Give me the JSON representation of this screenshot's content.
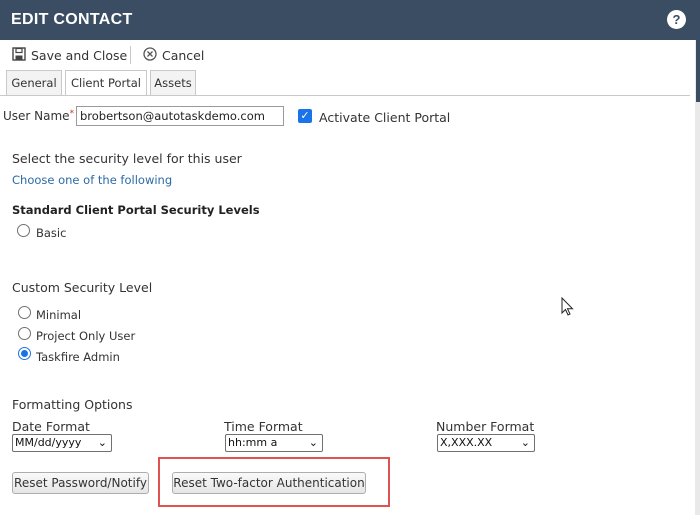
{
  "window": {
    "title": "EDIT CONTACT",
    "help_label": "?"
  },
  "toolbar": {
    "save_close_label": "Save and Close",
    "cancel_label": "Cancel"
  },
  "tabs": [
    {
      "label": "General",
      "active": false
    },
    {
      "label": "Client Portal",
      "active": true
    },
    {
      "label": "Assets",
      "active": false
    }
  ],
  "user": {
    "username_label": "User Name",
    "required_marker": "*",
    "username_value": "brobertson@autotaskdemo.com",
    "activate_label": "Activate Client Portal",
    "activate_checked": true
  },
  "security": {
    "heading": "Select the security level for this user",
    "choose_link": "Choose one of the following",
    "standard_heading": "Standard Client Portal Security Levels",
    "standard_options": [
      {
        "label": "Basic",
        "selected": false
      }
    ],
    "custom_heading": "Custom Security Level",
    "custom_options": [
      {
        "label": "Minimal",
        "selected": false
      },
      {
        "label": "Project Only User",
        "selected": false
      },
      {
        "label": "Taskfire Admin",
        "selected": true
      }
    ]
  },
  "formatting": {
    "heading": "Formatting Options",
    "date_label": "Date Format",
    "date_value": "MM/dd/yyyy",
    "time_label": "Time Format",
    "time_value": "hh:mm a",
    "number_label": "Number Format",
    "number_value": "X,XXX.XX"
  },
  "buttons": {
    "reset_password": "Reset Password/Notify",
    "reset_2fa": "Reset Two-factor Authentication"
  },
  "colors": {
    "titlebar": "#3a4d63",
    "accent": "#1a73e8",
    "highlight": "#e05252",
    "link": "#2b6aa6"
  }
}
